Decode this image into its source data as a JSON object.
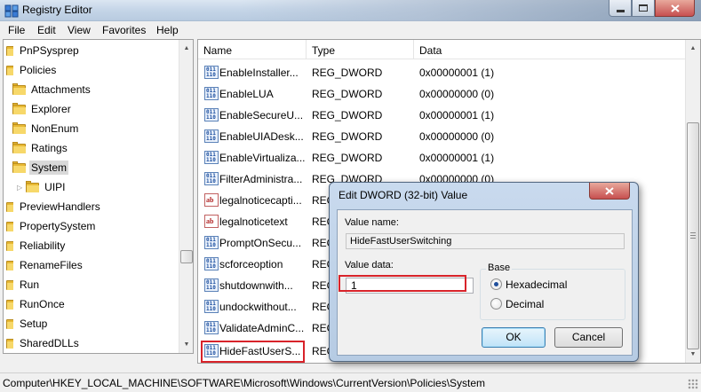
{
  "window": {
    "title": "Registry Editor"
  },
  "menu": [
    "File",
    "Edit",
    "View",
    "Favorites",
    "Help"
  ],
  "tree": {
    "items": [
      {
        "label": "PnPSysprep",
        "level": 0,
        "selected": false
      },
      {
        "label": "Policies",
        "level": 0,
        "selected": false
      },
      {
        "label": "Attachments",
        "level": 1,
        "selected": false
      },
      {
        "label": "Explorer",
        "level": 1,
        "selected": false
      },
      {
        "label": "NonEnum",
        "level": 1,
        "selected": false
      },
      {
        "label": "Ratings",
        "level": 1,
        "selected": false
      },
      {
        "label": "System",
        "level": 1,
        "selected": true
      },
      {
        "label": "UIPI",
        "level": 2,
        "selected": false
      },
      {
        "label": "PreviewHandlers",
        "level": 0,
        "selected": false
      },
      {
        "label": "PropertySystem",
        "level": 0,
        "selected": false
      },
      {
        "label": "Reliability",
        "level": 0,
        "selected": false
      },
      {
        "label": "RenameFiles",
        "level": 0,
        "selected": false
      },
      {
        "label": "Run",
        "level": 0,
        "selected": false
      },
      {
        "label": "RunOnce",
        "level": 0,
        "selected": false
      },
      {
        "label": "Setup",
        "level": 0,
        "selected": false
      },
      {
        "label": "SharedDLLs",
        "level": 0,
        "selected": false
      }
    ]
  },
  "list": {
    "columns": {
      "name": "Name",
      "type": "Type",
      "data": "Data"
    },
    "rows": [
      {
        "name": "EnableInstaller...",
        "type": "REG_DWORD",
        "data": "0x00000001 (1)",
        "icon": "binary-value-icon"
      },
      {
        "name": "EnableLUA",
        "type": "REG_DWORD",
        "data": "0x00000000 (0)",
        "icon": "binary-value-icon"
      },
      {
        "name": "EnableSecureU...",
        "type": "REG_DWORD",
        "data": "0x00000001 (1)",
        "icon": "binary-value-icon"
      },
      {
        "name": "EnableUIADesk...",
        "type": "REG_DWORD",
        "data": "0x00000000 (0)",
        "icon": "binary-value-icon"
      },
      {
        "name": "EnableVirtualiza...",
        "type": "REG_DWORD",
        "data": "0x00000001 (1)",
        "icon": "binary-value-icon"
      },
      {
        "name": "FilterAdministra...",
        "type": "REG_DWORD",
        "data": "0x00000000 (0)",
        "icon": "binary-value-icon"
      },
      {
        "name": "legalnoticecapti...",
        "type": "REG",
        "data": "",
        "icon": "string-value-icon"
      },
      {
        "name": "legalnoticetext",
        "type": "REG",
        "data": "",
        "icon": "string-value-icon"
      },
      {
        "name": "PromptOnSecu...",
        "type": "REG",
        "data": "",
        "icon": "binary-value-icon"
      },
      {
        "name": "scforceoption",
        "type": "REG",
        "data": "",
        "icon": "binary-value-icon"
      },
      {
        "name": "shutdownwith...",
        "type": "REG",
        "data": "",
        "icon": "binary-value-icon"
      },
      {
        "name": "undockwithout...",
        "type": "REG",
        "data": "",
        "icon": "binary-value-icon"
      },
      {
        "name": "ValidateAdminC...",
        "type": "REG",
        "data": "",
        "icon": "binary-value-icon"
      },
      {
        "name": "HideFastUserS...",
        "type": "REG",
        "data": "",
        "icon": "binary-value-icon"
      }
    ]
  },
  "status": {
    "path": "Computer\\HKEY_LOCAL_MACHINE\\SOFTWARE\\Microsoft\\Windows\\CurrentVersion\\Policies\\System"
  },
  "dialog": {
    "title": "Edit DWORD (32-bit) Value",
    "value_name_label": "Value name:",
    "value_name": "HideFastUserSwitching",
    "value_data_label": "Value data:",
    "value_data": "1",
    "base_label": "Base",
    "hex_label": "Hexadecimal",
    "dec_label": "Decimal",
    "base_selected": "Hexadecimal",
    "ok_label": "OK",
    "cancel_label": "Cancel"
  },
  "colors": {
    "highlight": "#d8232a",
    "titlebar": "#c6d6e8"
  }
}
